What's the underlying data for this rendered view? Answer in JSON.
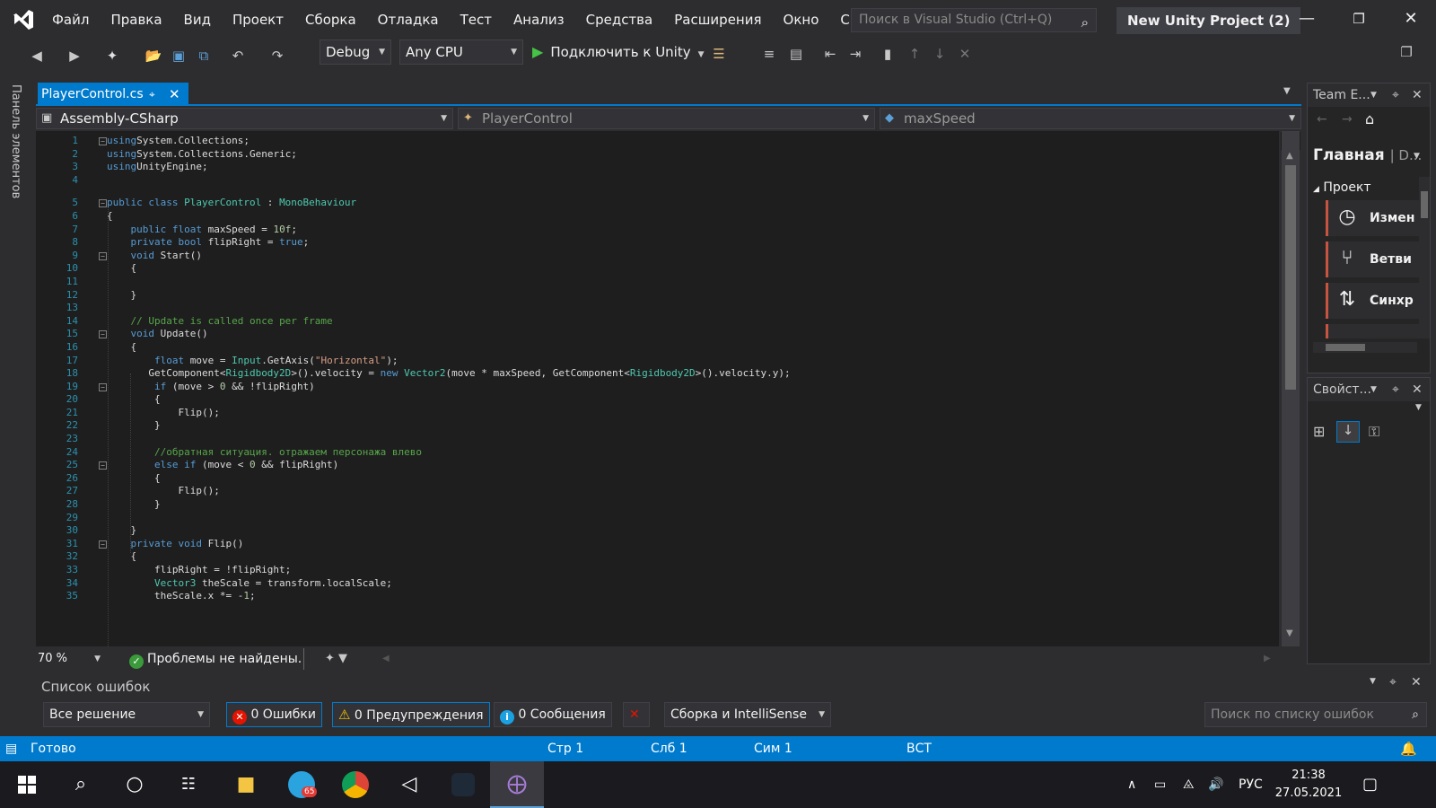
{
  "menu": {
    "items": [
      "Файл",
      "Правка",
      "Вид",
      "Проект",
      "Сборка",
      "Отладка",
      "Тест",
      "Анализ",
      "Средства",
      "Расширения",
      "Окно",
      "Справка"
    ],
    "search_placeholder": "Поиск в Visual Studio (Ctrl+Q)",
    "project_title": "New Unity Project (2)"
  },
  "toolbar": {
    "config": "Debug",
    "platform": "Any CPU",
    "attach": "Подключить к Unity"
  },
  "left_tab": "Панель элементов",
  "tab": {
    "file": "PlayerControl.cs"
  },
  "nav": {
    "project": "Assembly-CSharp",
    "class": "PlayerControl",
    "member": "maxSpeed"
  },
  "code": [
    {
      "n": "1",
      "fold": "⊟",
      "t": [
        [
          "kw",
          "using"
        ],
        [
          "",
          "System.Collections;"
        ]
      ]
    },
    {
      "n": "2",
      "t": [
        [
          "kw",
          "using"
        ],
        [
          "",
          "System.Collections.Generic;"
        ]
      ]
    },
    {
      "n": "3",
      "t": [
        [
          "kw",
          "using"
        ],
        [
          "",
          "UnityEngine;"
        ]
      ]
    },
    {
      "n": "4",
      "t": []
    },
    {
      "n": "5",
      "fold": "⊟",
      "t": [
        [
          "kw",
          "public class "
        ],
        [
          "ty",
          "PlayerControl"
        ],
        [
          "",
          " : "
        ],
        [
          "ty",
          "MonoBehaviour"
        ]
      ]
    },
    {
      "n": "6",
      "t": [
        [
          "",
          "{"
        ]
      ]
    },
    {
      "n": "7",
      "t": [
        [
          "",
          "    "
        ],
        [
          "kw",
          "public float "
        ],
        [
          "",
          "maxSpeed = "
        ],
        [
          "nm",
          "10f"
        ],
        [
          "",
          ";"
        ]
      ]
    },
    {
      "n": "8",
      "t": [
        [
          "",
          "    "
        ],
        [
          "kw",
          "private bool "
        ],
        [
          "",
          "flipRight = "
        ],
        [
          "kw",
          "true"
        ],
        [
          "",
          ";"
        ]
      ]
    },
    {
      "n": "9",
      "fold": "⊟",
      "t": [
        [
          "",
          "    "
        ],
        [
          "kw",
          "void "
        ],
        [
          "",
          "Start()"
        ]
      ]
    },
    {
      "n": "10",
      "t": [
        [
          "",
          "    {"
        ]
      ]
    },
    {
      "n": "11",
      "t": []
    },
    {
      "n": "12",
      "t": [
        [
          "",
          "    }"
        ]
      ]
    },
    {
      "n": "13",
      "t": []
    },
    {
      "n": "14",
      "t": [
        [
          "",
          "    "
        ],
        [
          "cm",
          "// Update is called once per frame"
        ]
      ]
    },
    {
      "n": "15",
      "fold": "⊟",
      "t": [
        [
          "",
          "    "
        ],
        [
          "kw",
          "void "
        ],
        [
          "",
          "Update()"
        ]
      ]
    },
    {
      "n": "16",
      "t": [
        [
          "",
          "    {"
        ]
      ]
    },
    {
      "n": "17",
      "t": [
        [
          "",
          "        "
        ],
        [
          "kw",
          "float "
        ],
        [
          "",
          "move = "
        ],
        [
          "ty",
          "Input"
        ],
        [
          "",
          ".GetAxis("
        ],
        [
          "st",
          "\"Horizontal\""
        ],
        [
          "",
          ");"
        ]
      ]
    },
    {
      "n": "18",
      "t": [
        [
          "",
          "       GetComponent<"
        ],
        [
          "ty",
          "Rigidbody2D"
        ],
        [
          "",
          ">().velocity = "
        ],
        [
          "kw",
          "new "
        ],
        [
          "ty",
          "Vector2"
        ],
        [
          "",
          "(move * maxSpeed, GetComponent<"
        ],
        [
          "ty",
          "Rigidbody2D"
        ],
        [
          "",
          ">().velocity.y);"
        ]
      ]
    },
    {
      "n": "19",
      "fold": "⊟",
      "t": [
        [
          "",
          "        "
        ],
        [
          "kw",
          "if "
        ],
        [
          "",
          "(move > "
        ],
        [
          "nm",
          "0"
        ],
        [
          "",
          " && !flipRight)"
        ]
      ]
    },
    {
      "n": "20",
      "t": [
        [
          "",
          "        {"
        ]
      ]
    },
    {
      "n": "21",
      "t": [
        [
          "",
          "            Flip();"
        ]
      ]
    },
    {
      "n": "22",
      "t": [
        [
          "",
          "        }"
        ]
      ]
    },
    {
      "n": "23",
      "t": []
    },
    {
      "n": "24",
      "t": [
        [
          "",
          "        "
        ],
        [
          "cm",
          "//обратная ситуация. отражаем персонажа влево"
        ]
      ]
    },
    {
      "n": "25",
      "fold": "⊟",
      "t": [
        [
          "",
          "        "
        ],
        [
          "kw",
          "else if "
        ],
        [
          "",
          "(move < "
        ],
        [
          "nm",
          "0"
        ],
        [
          "",
          " && flipRight)"
        ]
      ]
    },
    {
      "n": "26",
      "t": [
        [
          "",
          "        {"
        ]
      ]
    },
    {
      "n": "27",
      "t": [
        [
          "",
          "            Flip();"
        ]
      ]
    },
    {
      "n": "28",
      "t": [
        [
          "",
          "        }"
        ]
      ]
    },
    {
      "n": "29",
      "t": []
    },
    {
      "n": "30",
      "t": [
        [
          "",
          "    }"
        ]
      ]
    },
    {
      "n": "31",
      "fold": "⊟",
      "t": [
        [
          "",
          "    "
        ],
        [
          "kw",
          "private void "
        ],
        [
          "",
          "Flip()"
        ]
      ]
    },
    {
      "n": "32",
      "t": [
        [
          "",
          "    {"
        ]
      ]
    },
    {
      "n": "33",
      "t": [
        [
          "",
          "        flipRight = !flipRight;"
        ]
      ]
    },
    {
      "n": "34",
      "t": [
        [
          "",
          "        "
        ],
        [
          "ty",
          "Vector3"
        ],
        [
          "",
          " theScale = transform.localScale;"
        ]
      ]
    },
    {
      "n": "35",
      "t": [
        [
          "",
          "        theScale.x *= -"
        ],
        [
          "nm",
          "1"
        ],
        [
          "",
          ";"
        ]
      ]
    }
  ],
  "editor_status": {
    "zoom": "70 %",
    "problems": "Проблемы не найдены."
  },
  "team": {
    "title": "Team E...",
    "home": "Главная",
    "home_extra": "| D...",
    "section": "Проект",
    "items": [
      "Измен",
      "Ветви",
      "Синхр"
    ]
  },
  "props": {
    "title": "Свойст..."
  },
  "errors": {
    "title": "Список ошибок",
    "scope": "Все решение",
    "errors": "0 Ошибки",
    "warnings": "0 Предупреждения",
    "messages": "0 Сообщения",
    "build": "Сборка и IntelliSense",
    "search": "Поиск по списку ошибок"
  },
  "status": {
    "ready": "Готово",
    "line": "Стр 1",
    "col": "Слб 1",
    "ch": "Сим 1",
    "mode": "ВСТ"
  },
  "taskbar": {
    "telegram_badge": "65",
    "lang": "РУС",
    "time": "21:38",
    "date": "27.05.2021"
  },
  "colors": {
    "accent": "#007acc",
    "editor_bg": "#1e1e1e",
    "keyword": "#569cd6",
    "type": "#4ec9b0",
    "string": "#d69d85",
    "comment": "#57a64a"
  }
}
